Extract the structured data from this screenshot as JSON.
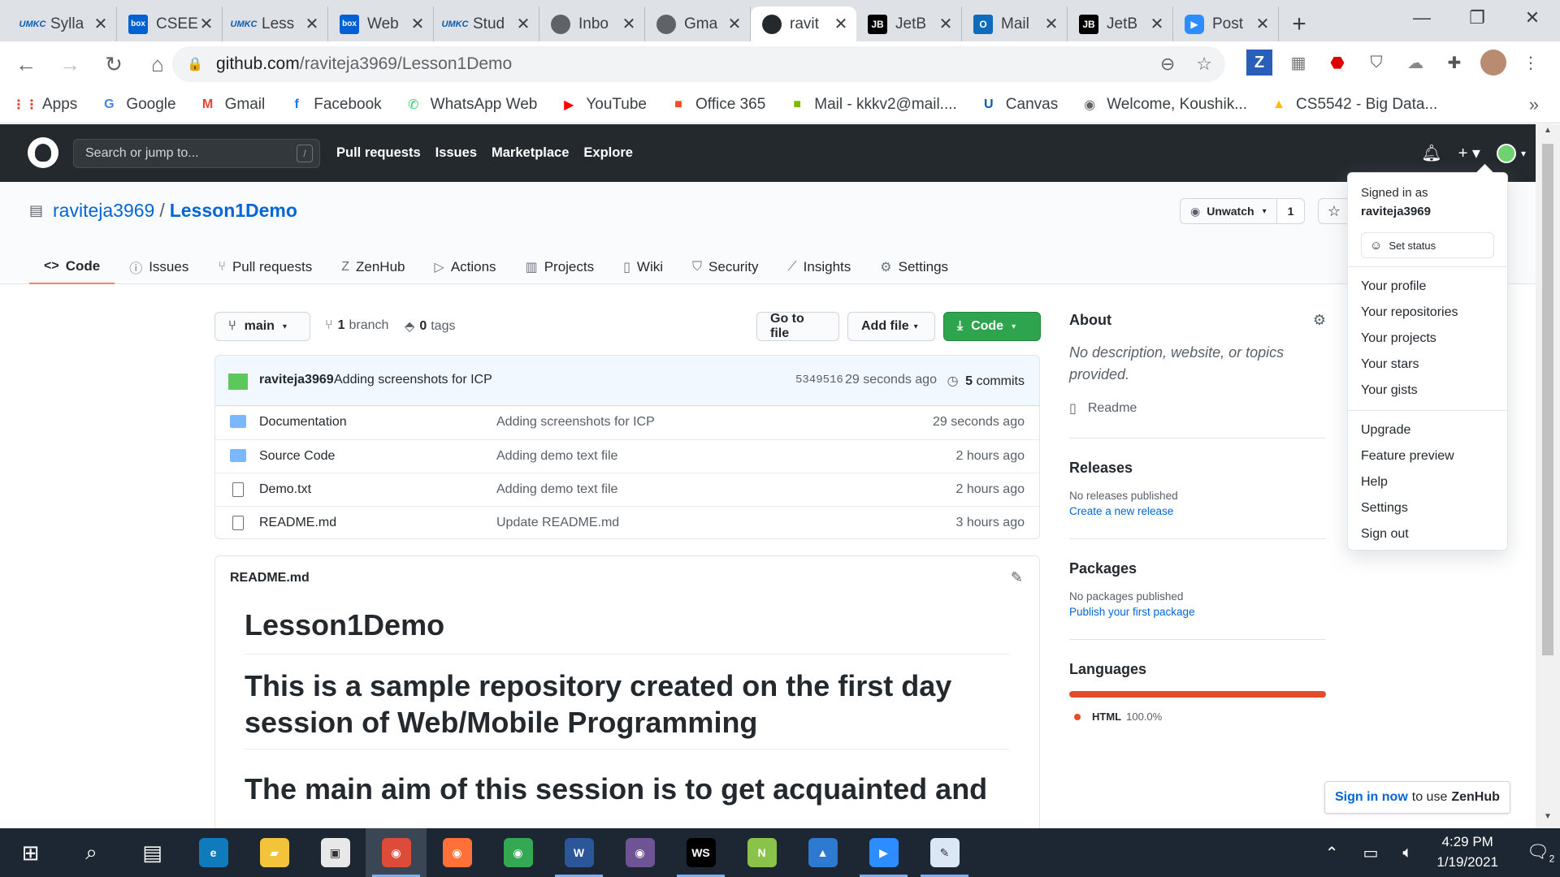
{
  "browser": {
    "tabs": [
      {
        "title": "Sylla",
        "icon": "umkc-logo-icon",
        "fav_text": "UMKC",
        "fav_class": "umkc"
      },
      {
        "title": "CSEE",
        "icon": "box-logo-icon",
        "fav_text": "box",
        "fav_class": "box"
      },
      {
        "title": "Less",
        "icon": "umkc-logo-icon",
        "fav_text": "UMKC",
        "fav_class": "umkc"
      },
      {
        "title": "Web",
        "icon": "box-logo-icon",
        "fav_text": "box",
        "fav_class": "box"
      },
      {
        "title": "Stud",
        "icon": "umkc-logo-icon",
        "fav_text": "UMKC",
        "fav_class": "umkc"
      },
      {
        "title": "Inbo",
        "icon": "globe-icon",
        "fav_text": "",
        "fav_class": "globe"
      },
      {
        "title": "Gma",
        "icon": "globe-icon",
        "fav_text": "",
        "fav_class": "globe"
      },
      {
        "title": "ravit",
        "icon": "github-logo-icon",
        "fav_text": "",
        "fav_class": "gh",
        "active": true
      },
      {
        "title": "JetB",
        "icon": "jetbrains-logo-icon",
        "fav_text": "JB",
        "fav_class": "jb"
      },
      {
        "title": "Mail",
        "icon": "outlook-logo-icon",
        "fav_text": "O",
        "fav_class": "outlook"
      },
      {
        "title": "JetB",
        "icon": "jetbrains-logo-icon",
        "fav_text": "JB",
        "fav_class": "jb"
      },
      {
        "title": "Post",
        "icon": "zoom-logo-icon",
        "fav_text": "▶",
        "fav_class": "zoom"
      }
    ],
    "url_host": "github.com",
    "url_path": "/raviteja3969/Lesson1Demo",
    "bookmarks": [
      {
        "label": "Apps",
        "icon": "apps-grid-icon",
        "glyph": "⋮⋮",
        "color": "#ea4335"
      },
      {
        "label": "Google",
        "icon": "google-logo-icon",
        "glyph": "G",
        "color": "#4285f4"
      },
      {
        "label": "Gmail",
        "icon": "gmail-logo-icon",
        "glyph": "M",
        "color": "#ea4335"
      },
      {
        "label": "Facebook",
        "icon": "facebook-logo-icon",
        "glyph": "f",
        "color": "#1877f2"
      },
      {
        "label": "WhatsApp Web",
        "icon": "whatsapp-logo-icon",
        "glyph": "✆",
        "color": "#25d366"
      },
      {
        "label": "YouTube",
        "icon": "youtube-logo-icon",
        "glyph": "▶",
        "color": "#ff0000"
      },
      {
        "label": "Office 365",
        "icon": "office-logo-icon",
        "glyph": "■",
        "color": "#f25022"
      },
      {
        "label": "Mail - kkkv2@mail....",
        "icon": "microsoft-logo-icon",
        "glyph": "■",
        "color": "#7fba00"
      },
      {
        "label": "Canvas",
        "icon": "umkc-logo-icon",
        "glyph": "U",
        "color": "#0b5cad"
      },
      {
        "label": "Welcome, Koushik...",
        "icon": "globe-icon",
        "glyph": "◉",
        "color": "#5f6368"
      },
      {
        "label": "CS5542 - Big Data...",
        "icon": "google-drive-icon",
        "glyph": "▲",
        "color": "#fbbc04"
      }
    ]
  },
  "github": {
    "search_placeholder": "Search or jump to...",
    "search_shortcut": "/",
    "nav": [
      "Pull requests",
      "Issues",
      "Marketplace",
      "Explore"
    ],
    "owner": "raviteja3969",
    "repo": "Lesson1Demo",
    "watch_label": "Unwatch",
    "watch_count": "1",
    "tabs": [
      {
        "label": "Code",
        "icon": "code-icon",
        "glyph": "<>",
        "selected": true
      },
      {
        "label": "Issues",
        "icon": "issue-icon",
        "glyph": "ⓘ"
      },
      {
        "label": "Pull requests",
        "icon": "pull-request-icon",
        "glyph": "⑂"
      },
      {
        "label": "ZenHub",
        "icon": "zenhub-icon",
        "glyph": "Z"
      },
      {
        "label": "Actions",
        "icon": "play-icon",
        "glyph": "▷"
      },
      {
        "label": "Projects",
        "icon": "project-icon",
        "glyph": "▥"
      },
      {
        "label": "Wiki",
        "icon": "book-icon",
        "glyph": "▯"
      },
      {
        "label": "Security",
        "icon": "shield-icon",
        "glyph": "⛉"
      },
      {
        "label": "Insights",
        "icon": "graph-icon",
        "glyph": "⟋"
      },
      {
        "label": "Settings",
        "icon": "gear-icon",
        "glyph": "⚙"
      }
    ],
    "branch": "main",
    "branch_count": "1",
    "branch_label": "branch",
    "tag_count": "0",
    "tag_label": "tags",
    "go_to_file": "Go to file",
    "add_file": "Add file",
    "code_button": "Code",
    "last_commit": {
      "author": "raviteja3969",
      "message": "Adding screenshots for ICP",
      "sha": "5349516",
      "when": "29 seconds ago",
      "commit_count": "5",
      "commit_label": "commits"
    },
    "files": [
      {
        "name": "Documentation",
        "type": "folder",
        "message": "Adding screenshots for ICP",
        "age": "29 seconds ago"
      },
      {
        "name": "Source Code",
        "type": "folder",
        "message": "Adding demo text file",
        "age": "2 hours ago"
      },
      {
        "name": "Demo.txt",
        "type": "file",
        "message": "Adding demo text file",
        "age": "2 hours ago"
      },
      {
        "name": "README.md",
        "type": "file",
        "message": "Update README.md",
        "age": "3 hours ago"
      }
    ],
    "readme": {
      "filename": "README.md",
      "h1": "Lesson1Demo",
      "h2a": "This is a sample repository created on the first day session of Web/Mobile Programming",
      "h2b": "The main aim of this session is to get acquainted and"
    },
    "about": {
      "heading": "About",
      "description": "No description, website, or topics provided.",
      "readme_link": "Readme"
    },
    "releases": {
      "heading": "Releases",
      "none": "No releases published",
      "link": "Create a new release"
    },
    "packages": {
      "heading": "Packages",
      "none": "No packages published",
      "link": "Publish your first package"
    },
    "languages": {
      "heading": "Languages",
      "name": "HTML",
      "percent": "100.0%",
      "color": "#e34c26"
    },
    "zenhub": {
      "link": "Sign in now",
      "middle": "to use",
      "brand": "ZenHub"
    },
    "dropdown": {
      "signed_in_as": "Signed in as",
      "username": "raviteja3969",
      "set_status": "Set status",
      "group1": [
        "Your profile",
        "Your repositories",
        "Your projects",
        "Your stars",
        "Your gists"
      ],
      "group2": [
        "Upgrade",
        "Feature preview",
        "Help",
        "Settings",
        "Sign out"
      ]
    }
  },
  "taskbar": {
    "time": "4:29 PM",
    "date": "1/19/2021",
    "notification_count": "2",
    "apps": [
      {
        "name": "start-icon",
        "glyph": "⊞",
        "bg": "transparent"
      },
      {
        "name": "search-icon",
        "glyph": "⌕",
        "bg": "transparent"
      },
      {
        "name": "task-view-icon",
        "glyph": "▤",
        "bg": "transparent"
      },
      {
        "name": "edge-icon",
        "glyph": "e",
        "bg": "#0f7bbd",
        "run": false
      },
      {
        "name": "file-explorer-icon",
        "glyph": "▰",
        "bg": "#f3c33b"
      },
      {
        "name": "store-icon",
        "glyph": "▣",
        "bg": "#e8e8e8"
      },
      {
        "name": "chrome-icon",
        "glyph": "◉",
        "bg": "#dd4b39",
        "run": true,
        "active": true
      },
      {
        "name": "firefox-icon",
        "glyph": "◉",
        "bg": "#ff7139"
      },
      {
        "name": "chrome-profile-icon",
        "glyph": "◉",
        "bg": "#34a853"
      },
      {
        "name": "word-icon",
        "glyph": "W",
        "bg": "#2b579a",
        "run": true
      },
      {
        "name": "github-desktop-icon",
        "glyph": "◉",
        "bg": "#6e5494"
      },
      {
        "name": "webstorm-icon",
        "glyph": "WS",
        "bg": "#000",
        "run": true
      },
      {
        "name": "notepad-plus-icon",
        "glyph": "N",
        "bg": "#8bc34a"
      },
      {
        "name": "photos-icon",
        "glyph": "▲",
        "bg": "#2f7ad1"
      },
      {
        "name": "zoom-icon",
        "glyph": "▶",
        "bg": "#2d8cff",
        "run": true
      },
      {
        "name": "paint-icon",
        "glyph": "✎",
        "bg": "#dce7f5",
        "run": true
      }
    ]
  }
}
